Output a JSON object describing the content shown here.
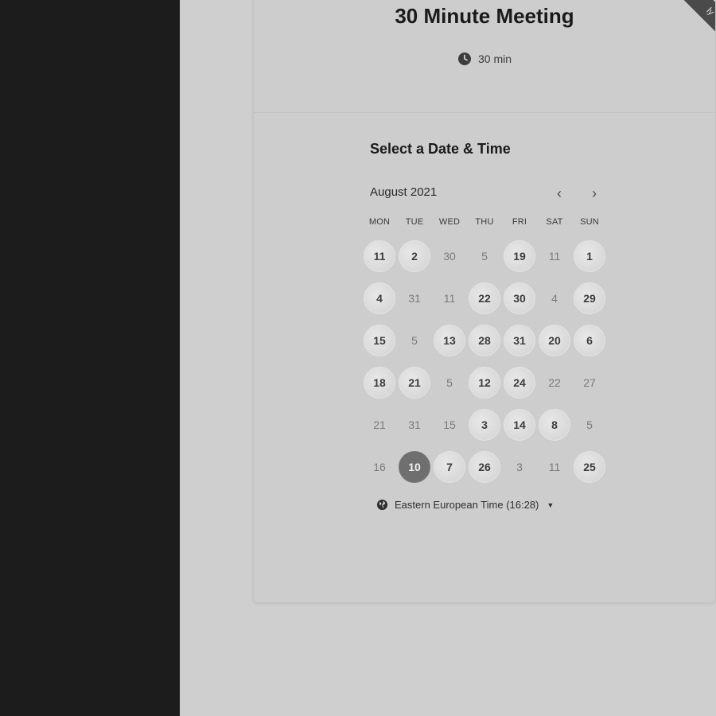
{
  "header": {
    "title": "30 Minute Meeting",
    "duration": "30 min",
    "ribbon_text": "ly"
  },
  "scheduler": {
    "section_title": "Select a Date & Time",
    "month_label": "August 2021",
    "prev_icon": "‹",
    "next_icon": "›",
    "weekdays": [
      "MON",
      "TUE",
      "WED",
      "THU",
      "FRI",
      "SAT",
      "SUN"
    ],
    "days": [
      {
        "label": "11",
        "state": "available"
      },
      {
        "label": "2",
        "state": "available"
      },
      {
        "label": "30",
        "state": "unavailable"
      },
      {
        "label": "5",
        "state": "unavailable"
      },
      {
        "label": "19",
        "state": "available"
      },
      {
        "label": "11",
        "state": "unavailable"
      },
      {
        "label": "1",
        "state": "available"
      },
      {
        "label": "4",
        "state": "available"
      },
      {
        "label": "31",
        "state": "unavailable"
      },
      {
        "label": "11",
        "state": "unavailable"
      },
      {
        "label": "22",
        "state": "available"
      },
      {
        "label": "30",
        "state": "available"
      },
      {
        "label": "4",
        "state": "unavailable"
      },
      {
        "label": "29",
        "state": "available"
      },
      {
        "label": "15",
        "state": "available"
      },
      {
        "label": "5",
        "state": "unavailable"
      },
      {
        "label": "13",
        "state": "available"
      },
      {
        "label": "28",
        "state": "available"
      },
      {
        "label": "31",
        "state": "available"
      },
      {
        "label": "20",
        "state": "available"
      },
      {
        "label": "6",
        "state": "available"
      },
      {
        "label": "18",
        "state": "available"
      },
      {
        "label": "21",
        "state": "available"
      },
      {
        "label": "5",
        "state": "unavailable"
      },
      {
        "label": "12",
        "state": "available"
      },
      {
        "label": "24",
        "state": "available"
      },
      {
        "label": "22",
        "state": "unavailable"
      },
      {
        "label": "27",
        "state": "unavailable"
      },
      {
        "label": "21",
        "state": "unavailable"
      },
      {
        "label": "31",
        "state": "unavailable"
      },
      {
        "label": "15",
        "state": "unavailable"
      },
      {
        "label": "3",
        "state": "available"
      },
      {
        "label": "14",
        "state": "available"
      },
      {
        "label": "8",
        "state": "available"
      },
      {
        "label": "5",
        "state": "unavailable"
      },
      {
        "label": "16",
        "state": "unavailable"
      },
      {
        "label": "10",
        "state": "selected"
      },
      {
        "label": "7",
        "state": "available"
      },
      {
        "label": "26",
        "state": "available"
      },
      {
        "label": "3",
        "state": "unavailable"
      },
      {
        "label": "11",
        "state": "unavailable"
      },
      {
        "label": "25",
        "state": "available"
      }
    ],
    "timezone": "Eastern European Time (16:28)"
  },
  "colors": {
    "left_panel": "#1c1c1c",
    "background": "#cfcfcf",
    "selected_day": "#6f6f6f"
  },
  "icons": {
    "clock": "clock-icon",
    "globe": "globe-icon",
    "caret": "caret-down-icon"
  }
}
